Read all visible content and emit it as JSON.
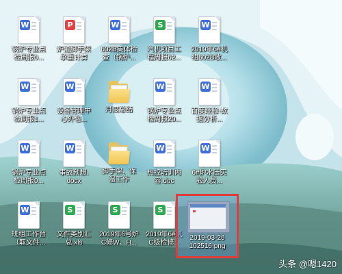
{
  "desktop": {
    "icons": [
      {
        "type": "word",
        "label": "锅炉专业点\n检周报0..."
      },
      {
        "type": "pdf",
        "label": "炉渣脚手架\n承重计算"
      },
      {
        "type": "word",
        "label": "602B集体检\n查（锅炉..."
      },
      {
        "type": "excel",
        "label": "汽机项目工\n程周报62..."
      },
      {
        "type": "word",
        "label": "2019年6#机\n组602B收..."
      },
      {
        "type": "word",
        "label": "锅炉专业点\n检周报1..."
      },
      {
        "type": "word",
        "label": "设备管理中\n心外包..."
      },
      {
        "type": "folder",
        "label": "月度总结"
      },
      {
        "type": "word",
        "label": "锅炉专业点\n检周报20..."
      },
      {
        "type": "word",
        "label": "百度经验-数\n据分析..."
      },
      {
        "type": "word",
        "label": "锅炉专业点\n检周报0..."
      },
      {
        "type": "word",
        "label": "事故预想.\ndocx"
      },
      {
        "type": "folder",
        "label": "脚手架、保\n温工作"
      },
      {
        "type": "word",
        "label": "热控培训内\n容.doc"
      },
      {
        "type": "word",
        "label": "6#炉水压实\n验人员..."
      },
      {
        "type": "word",
        "label": "班组工作台\n（取文件..."
      },
      {
        "type": "excel",
        "label": "文件类别汇\n总.xls"
      },
      {
        "type": "excel",
        "label": "2019年6号炉\nC修W、H..."
      },
      {
        "type": "excel",
        "label": "2019年6#机\nC级检修..."
      }
    ],
    "selected_file": {
      "type": "image",
      "label": "2019-03-26\n102516.png"
    },
    "watermark": "头条 @嗯1420"
  }
}
